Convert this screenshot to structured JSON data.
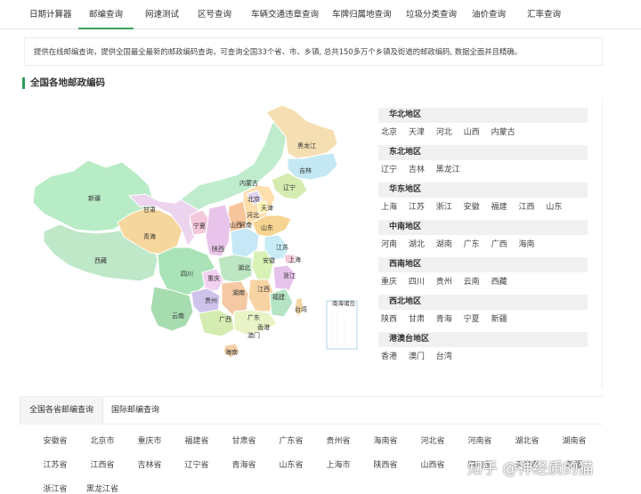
{
  "nav": {
    "tabs": [
      "日期计算器",
      "邮编查询",
      "网速测试",
      "区号查询",
      "车辆交通违章查询",
      "车牌归属地查询",
      "垃圾分类查询",
      "油价查询",
      "汇率查询"
    ],
    "active_index": 1
  },
  "notice": "提供在线邮编查询，提供全国最全最新的邮政编码查询，可查询全国33个省、市、乡镇, 总共150多万个乡镇及街道的邮政编码, 数据全面并且精确。",
  "section_title": "全国各地邮政编码",
  "map": {
    "labels": [
      "黑龙江",
      "吉林",
      "辽宁",
      "内蒙古",
      "北京",
      "天津",
      "河北",
      "山西",
      "山东",
      "新疆",
      "甘肃",
      "宁夏",
      "陕西",
      "河南",
      "江苏",
      "青海",
      "西藏",
      "四川",
      "重庆",
      "湖北",
      "安徽",
      "上海",
      "浙江",
      "贵州",
      "湖南",
      "江西",
      "福建",
      "云南",
      "广西",
      "广东",
      "台湾",
      "香港",
      "澳门",
      "海南",
      "南海诸岛"
    ]
  },
  "regions": [
    {
      "name": "华北地区",
      "items": [
        "北京",
        "天津",
        "河北",
        "山西",
        "内蒙古"
      ]
    },
    {
      "name": "东北地区",
      "items": [
        "辽宁",
        "吉林",
        "黑龙江"
      ]
    },
    {
      "name": "华东地区",
      "items": [
        "上海",
        "江苏",
        "浙江",
        "安徽",
        "福建",
        "江西",
        "山东"
      ]
    },
    {
      "name": "中南地区",
      "items": [
        "河南",
        "湖北",
        "湖南",
        "广东",
        "广西",
        "海南"
      ]
    },
    {
      "name": "西南地区",
      "items": [
        "重庆",
        "四川",
        "贵州",
        "云南",
        "西藏"
      ]
    },
    {
      "name": "西北地区",
      "items": [
        "陕西",
        "甘肃",
        "青海",
        "宁夏",
        "新疆"
      ]
    },
    {
      "name": "港澳台地区",
      "items": [
        "香港",
        "澳门",
        "台湾"
      ]
    }
  ],
  "bottom_tabs": [
    "全国各省邮编查询",
    "国际邮编查询"
  ],
  "provinces": [
    "安徽省",
    "北京市",
    "重庆市",
    "福建省",
    "甘肃省",
    "广东省",
    "贵州省",
    "海南省",
    "河北省",
    "河南省",
    "湖北省",
    "湖南省",
    "江苏省",
    "江西省",
    "吉林省",
    "辽宁省",
    "青海省",
    "山东省",
    "上海市",
    "陕西省",
    "山西省",
    "四川省",
    "天津市",
    "新疆",
    "浙江省",
    "黑龙江省"
  ],
  "watermark": "知乎 @神经质的猫",
  "colors": {
    "accent": "#3aa35a"
  }
}
